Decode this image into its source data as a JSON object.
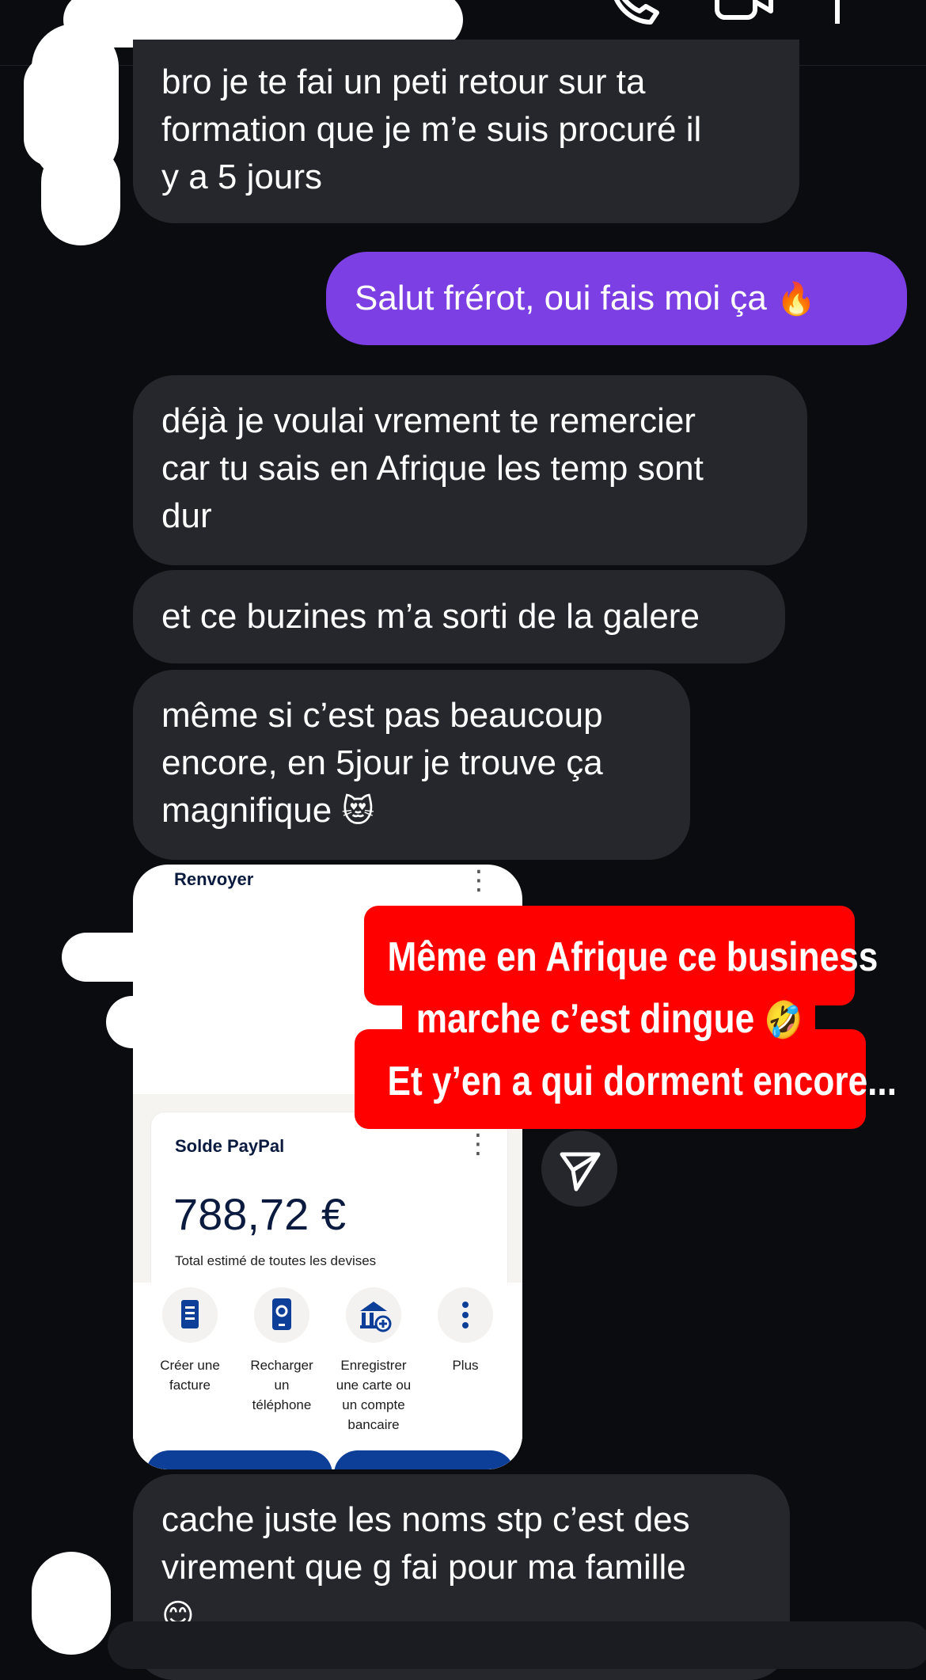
{
  "messages": [
    {
      "id": "m1",
      "side": "them",
      "lines": [
        "bro je te fai un peti retour sur ta",
        "formation que je m’e suis procuré il",
        "y a 5 jours"
      ]
    },
    {
      "id": "m2",
      "side": "me",
      "text": "Salut frérot, oui fais moi ça",
      "emoji": "🔥"
    },
    {
      "id": "m3",
      "side": "them",
      "lines": [
        "déjà je voulai vrement te remercier",
        "car tu sais en Afrique les temp sont",
        "dur"
      ]
    },
    {
      "id": "m4",
      "side": "them",
      "lines": [
        "et ce buzines m’a sorti de la galere"
      ]
    },
    {
      "id": "m5",
      "side": "them",
      "lines": [
        "même si c’est pas beaucoup",
        "encore, en 5jour je trouve ça",
        "magnifique"
      ],
      "emoji": "😻"
    },
    {
      "id": "m6",
      "side": "them",
      "lines": [
        "cache juste les noms stp c’est des",
        "virement que g fai pour ma famille"
      ],
      "emoji": "😊"
    }
  ],
  "screenshot": {
    "header": "Renvoyer",
    "card_title": "Solde PayPal",
    "amount": "788,72 €",
    "note": "Total estimé de toutes les devises",
    "actions": [
      {
        "label_lines": [
          "Créer une",
          "facture"
        ],
        "icon": "invoice-icon"
      },
      {
        "label_lines": [
          "Recharger",
          "un",
          "téléphone"
        ],
        "icon": "phone-recharge-icon"
      },
      {
        "label_lines": [
          "Enregistrer",
          "une carte ou",
          "un compte",
          "bancaire"
        ],
        "icon": "bank-add-icon"
      },
      {
        "label_lines": [
          "Plus"
        ],
        "icon": "more-vertical-icon"
      }
    ]
  },
  "overlay": {
    "lines": [
      "Même en Afrique ce business",
      "marche c’est dingue",
      "Et y’en a qui dorment encore..."
    ],
    "emoji": "🤣",
    "color": "#ff0000"
  },
  "icons": {
    "call": "phone-icon",
    "video": "video-icon",
    "flag": "flag-icon",
    "send": "send-icon"
  },
  "colors": {
    "background": "#0b0c0f",
    "bubble_them": "#26272d",
    "bubble_me": "#7b3fe4",
    "paypal_blue": "#0e3f98"
  }
}
